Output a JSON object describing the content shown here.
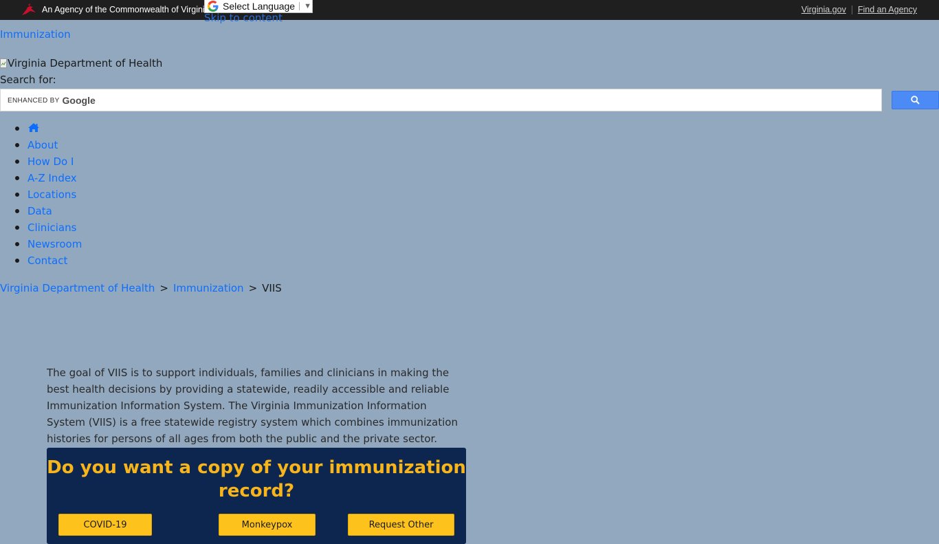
{
  "topbar": {
    "agency_text": "An Agency of the Commonwealth of Virginia",
    "language_select": "Select Language",
    "skip_link": "Skip to content",
    "links": [
      "Virginia.gov",
      "Find an Agency"
    ]
  },
  "header": {
    "site_link": "Immunization",
    "logo_alt": "Virginia Department of Health",
    "search_label": "Search for:",
    "search_enhanced_by": "ENHANCED BY",
    "search_brand": "Google",
    "search_value": ""
  },
  "nav": {
    "items": [
      "About",
      "How Do I",
      "A-Z Index",
      "Locations",
      "Data",
      "Clinicians",
      "Newsroom",
      "Contact"
    ]
  },
  "breadcrumb": {
    "items": [
      "Virginia Department of Health",
      "Immunization"
    ],
    "current": "VIIS",
    "separator": ">"
  },
  "main": {
    "intro": "The goal of VIIS is to support individuals, families and clinicians in making the best health decisions by providing a statewide, readily accessible and reliable Immunization Information System. The Virginia Immunization Information System (VIIS) is a free statewide registry system which combines immunization histories for persons of all ages from both the public and the private sector.",
    "cta_title": "Do you want a copy of your immunization record?",
    "cta_buttons": [
      "COVID-19",
      "Monkeypox",
      "Request Other"
    ]
  },
  "colors": {
    "background": "#92a8bf",
    "topbar": "#1f1f1f",
    "link": "#0d6efd",
    "cta_panel": "#0c2650",
    "cta_title": "#f7b51b",
    "cta_button": "#fdc31c"
  }
}
